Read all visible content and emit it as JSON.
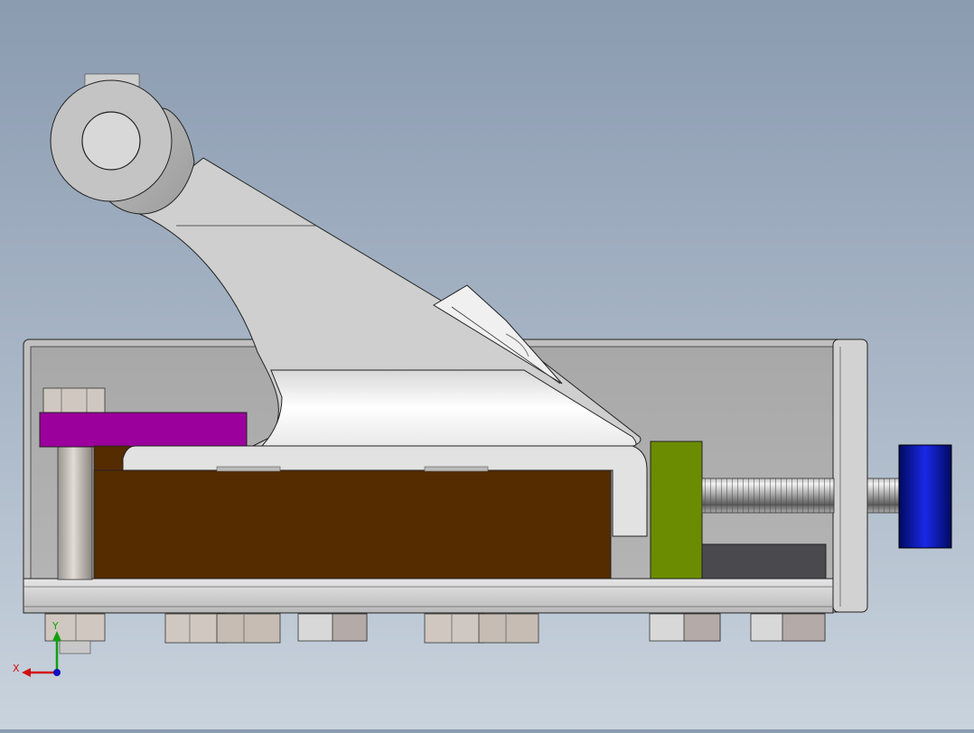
{
  "view": {
    "background_top": "#8b9bb0",
    "background_bottom": "#c9d3dd"
  },
  "triad": {
    "x_label": "X",
    "y_label": "Y",
    "x_color": "#d01010",
    "y_color": "#10a010",
    "z_color": "#1010c0"
  },
  "parts": {
    "base_plate_color": "#c8c8c8",
    "lever_arm_color": "#cfcfcf",
    "clamp_block_color": "#552b00",
    "purple_bar_color": "#9c009c",
    "green_block_color": "#6b8c00",
    "knob_color": "#0a14c8",
    "dark_pad_color": "#4a4a4e"
  }
}
